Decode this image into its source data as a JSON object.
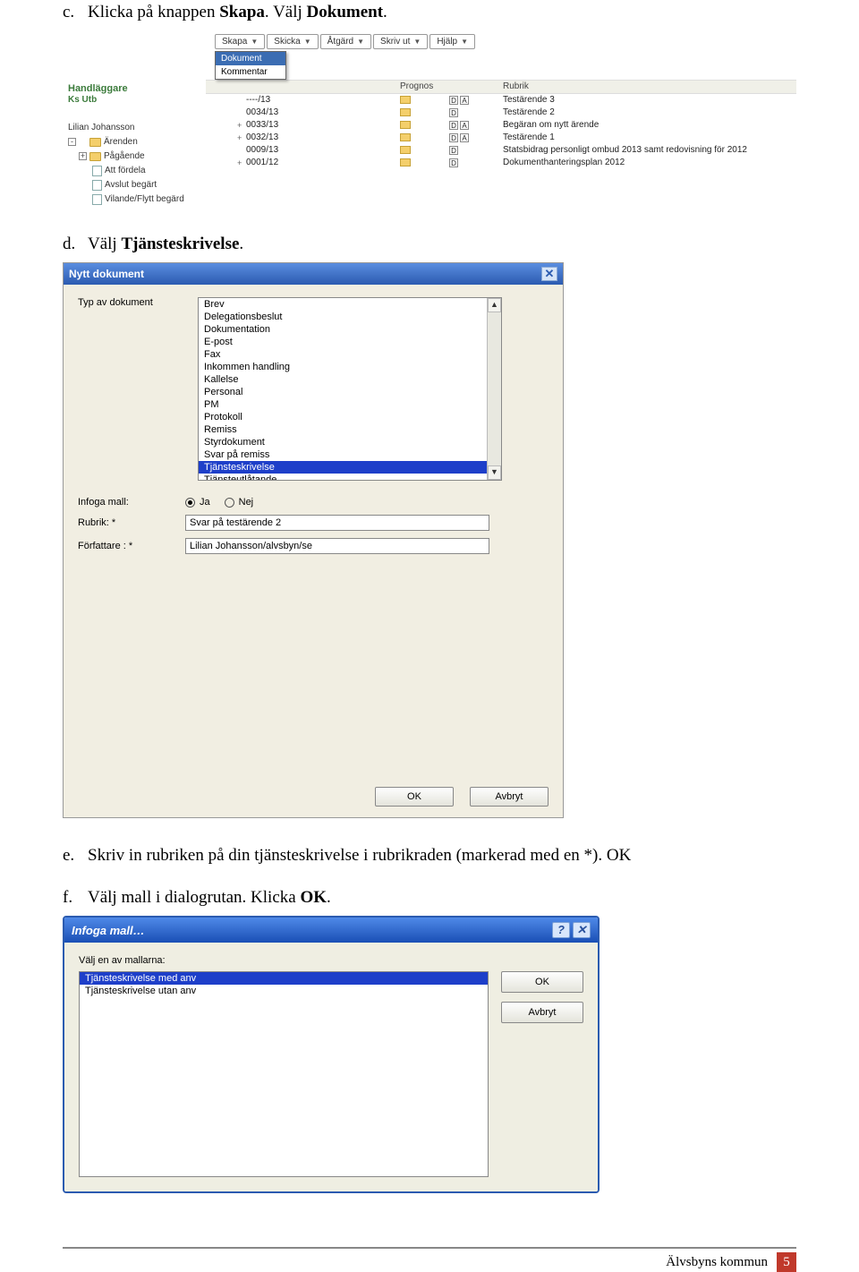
{
  "instruction_c": {
    "letter": "c.",
    "pre": "Klicka på knappen ",
    "b1": "Skapa",
    "mid": ". Välj ",
    "b2": "Dokument",
    "post": "."
  },
  "instruction_d": {
    "letter": "d.",
    "pre": "Välj ",
    "b1": "Tjänsteskrivelse",
    "post": "."
  },
  "instruction_e": {
    "letter": "e.",
    "text": "Skriv in rubriken på din tjänsteskrivelse i rubrikraden (markerad med en *). OK"
  },
  "instruction_f": {
    "letter": "f.",
    "pre": "Välj mall i dialogrutan. Klicka ",
    "b1": "OK",
    "post": "."
  },
  "ss1": {
    "toolbar": [
      "Skapa",
      "Skicka",
      "Åtgärd",
      "Skriv ut",
      "Hjälp"
    ],
    "dropdown": [
      "Dokument",
      "Kommentar"
    ],
    "side_title": "Handläggare",
    "side_sub": "Ks Utb",
    "user": "Lilian Johansson",
    "tree": [
      {
        "exp": "-",
        "icon": "folder",
        "indent": 1,
        "label": "Ärenden"
      },
      {
        "exp": "+",
        "icon": "folder",
        "indent": 2,
        "label": "Pågående"
      },
      {
        "exp": "",
        "icon": "doc",
        "indent": 2,
        "label": "Att fördela"
      },
      {
        "exp": "",
        "icon": "doc",
        "indent": 2,
        "label": "Avslut begärt"
      },
      {
        "exp": "",
        "icon": "doc",
        "indent": 2,
        "label": "Vilande/Flytt begärd"
      }
    ],
    "headers": [
      "",
      "Prognos",
      "",
      "Rubrik"
    ],
    "rows": [
      {
        "exp": "",
        "c1": "----/13",
        "c3": [
          "D",
          "A"
        ],
        "c4": "Testärende 3"
      },
      {
        "exp": "",
        "c1": "0034/13",
        "c3": [
          "D"
        ],
        "c4": "Testärende 2"
      },
      {
        "exp": "+",
        "c1": "0033/13",
        "c3": [
          "D",
          "A"
        ],
        "c4": "Begäran om nytt ärende"
      },
      {
        "exp": "+",
        "c1": "0032/13",
        "c3": [
          "D",
          "A"
        ],
        "c4": "Testärende 1"
      },
      {
        "exp": "",
        "c1": "0009/13",
        "c3": [
          "D"
        ],
        "c4": "Statsbidrag personligt ombud 2013 samt redovisning för 2012"
      },
      {
        "exp": "+",
        "c1": "0001/12",
        "c3": [
          "D"
        ],
        "c4": "Dokumenthanteringsplan 2012"
      }
    ]
  },
  "ss2": {
    "title": "Nytt dokument",
    "label_type": "Typ av dokument",
    "list": [
      "Brev",
      "Delegationsbeslut",
      "Dokumentation",
      "E-post",
      "Fax",
      "Inkommen handling",
      "Kallelse",
      "Personal",
      "PM",
      "Protokoll",
      "Remiss",
      "Styrdokument",
      "Svar på remiss",
      "Tjänsteskrivelse",
      "Tjänsteutlåtande"
    ],
    "selected_index": 13,
    "label_infoga": "Infoga mall:",
    "radio_ja": "Ja",
    "radio_nej": "Nej",
    "label_rubrik": "Rubrik: *",
    "rubrik_value": "Svar på testärende 2",
    "label_forf": "Författare : *",
    "forf_value": "Lilian Johansson/alvsbyn/se",
    "btn_ok": "OK",
    "btn_cancel": "Avbryt"
  },
  "ss3": {
    "title": "Infoga mall…",
    "prompt": "Välj en av mallarna:",
    "list": [
      "Tjänsteskrivelse med anv",
      "Tjänsteskrivelse utan anv"
    ],
    "selected_index": 0,
    "btn_ok": "OK",
    "btn_cancel": "Avbryt"
  },
  "footer": {
    "org": "Älvsbyns kommun",
    "page": "5"
  }
}
